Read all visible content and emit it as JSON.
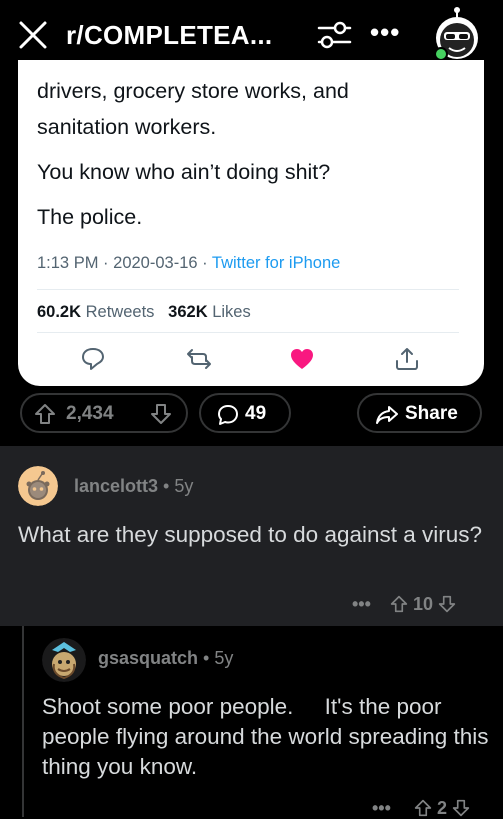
{
  "header": {
    "subreddit_title": "r/COMPLETEA...",
    "icons": [
      "close-icon",
      "filter-icon",
      "more-icon",
      "avatar"
    ],
    "more_label": "•••"
  },
  "tweet": {
    "lines": [
      "drivers, grocery store works, and",
      "sanitation workers.",
      "You know who ain’t doing shit?",
      "The police."
    ],
    "time": "1:13 PM",
    "date": "2020-03-16",
    "source": "Twitter for iPhone",
    "retweets_count": "60.2K",
    "retweets_label": "Retweets",
    "likes_count": "362K",
    "likes_label": "Likes",
    "action_icons": [
      "reply-icon",
      "retweet-icon",
      "heart-icon",
      "share-icon"
    ],
    "heart_color": "#f91880"
  },
  "post_actions": {
    "score": "2,434",
    "comments": "49",
    "share_label": "Share"
  },
  "comments": [
    {
      "username": "lancelott3",
      "separator": "•",
      "age": "5y",
      "body": "What are they supposed to do against a virus?",
      "more": "•••",
      "score": "10"
    },
    {
      "username": "gsasquatch",
      "separator": "•",
      "age": "5y",
      "body": "Shoot some poor people.     It's the poor people flying around the world spreading this thing you know.",
      "more": "•••",
      "score": "2"
    }
  ],
  "colors": {
    "background": "#000000",
    "comment_bg": "#202124",
    "meta_text": "#818384",
    "link_blue": "#1d9bf0",
    "online_dot": "#46d160"
  }
}
